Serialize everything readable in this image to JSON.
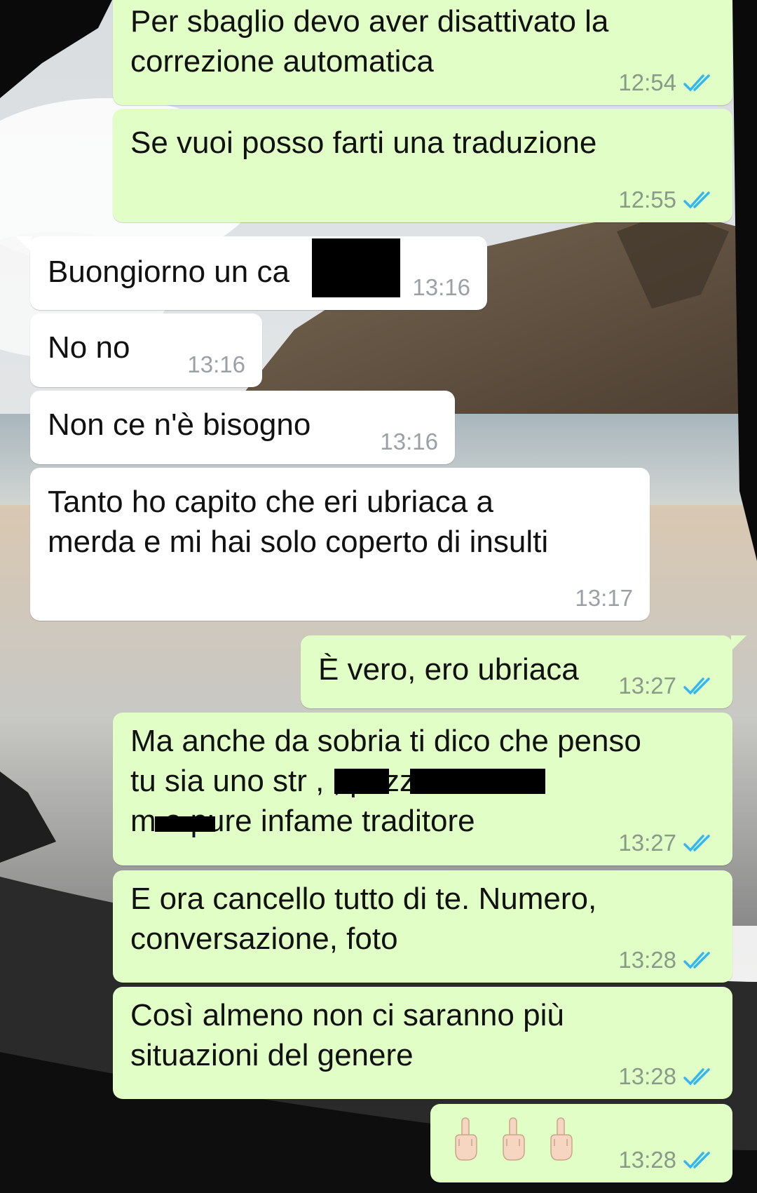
{
  "theme": {
    "outgoing_bubble": "#e1fec6",
    "incoming_bubble": "#ffffff",
    "read_tick_color": "#34b7f1"
  },
  "messages": [
    {
      "dir": "out",
      "text": "Per sbaglio devo aver disattivato la\ncorrezione automatica",
      "time": "12:54",
      "status": "read-double-tick-icon"
    },
    {
      "dir": "out",
      "text": "Se vuoi posso farti una traduzione",
      "time": "12:55",
      "status": "read-double-tick-icon"
    },
    {
      "dir": "in",
      "text": "Buongiorno un ca",
      "time": "13:16",
      "redacted": true
    },
    {
      "dir": "in",
      "text": "No no",
      "time": "13:16"
    },
    {
      "dir": "in",
      "text": "Non ce n'è bisogno",
      "time": "13:16"
    },
    {
      "dir": "in",
      "text": "Tanto ho capito che eri ubriaca a\nmerda e mi hai solo coperto di insulti",
      "time": "13:17"
    },
    {
      "dir": "out",
      "text": "È vero, ero ubriaca",
      "time": "13:27",
      "status": "read-double-tick-icon"
    },
    {
      "dir": "out",
      "text": "Ma anche da sobria ti dico che penso\ntu sia uno str      ,                     , pezzo di\nm         e pure infame traditore",
      "time": "13:27",
      "status": "read-double-tick-icon",
      "redacted": true
    },
    {
      "dir": "out",
      "text": "E ora cancello tutto di te. Numero,\nconversazione, foto",
      "time": "13:28",
      "status": "read-double-tick-icon"
    },
    {
      "dir": "out",
      "text": "Così almeno non ci saranno più\nsituazioni del genere",
      "time": "13:28",
      "status": "read-double-tick-icon"
    },
    {
      "dir": "out",
      "emoji": [
        "middle-finger-emoji",
        "middle-finger-emoji",
        "middle-finger-emoji"
      ],
      "time": "13:28",
      "status": "read-double-tick-icon"
    }
  ]
}
